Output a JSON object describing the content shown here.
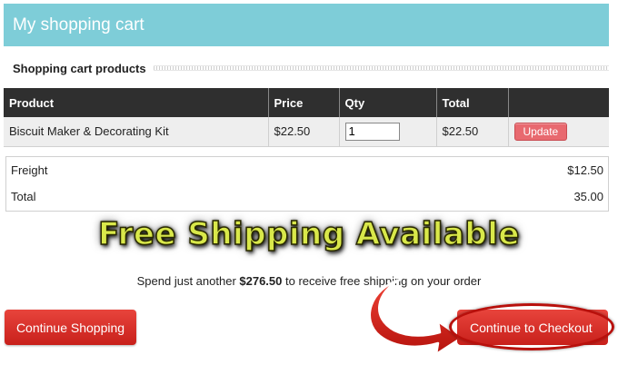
{
  "header": {
    "title": "My shopping cart"
  },
  "section": {
    "title": "Shopping cart products"
  },
  "table": {
    "columns": [
      "Product",
      "Price",
      "Qty",
      "Total",
      ""
    ],
    "rows": [
      {
        "product": "Biscuit Maker & Decorating Kit",
        "price": "$22.50",
        "qty": "1",
        "total": "$22.50",
        "action": "Update"
      }
    ]
  },
  "totals": {
    "freight_label": "Freight",
    "freight_value": "$12.50",
    "total_label": "Total",
    "total_value": "35.00"
  },
  "promo": {
    "text": "Free Shipping Available"
  },
  "notice": {
    "prefix": "Spend just another ",
    "amount": "$276.50",
    "suffix": " to receive free shipping on your order"
  },
  "buttons": {
    "continue_shopping": "Continue Shopping",
    "checkout": "Continue to Checkout"
  },
  "colors": {
    "header_bg": "#7ecdd8",
    "table_header_bg": "#2f2f2f",
    "button_red": "#d9302a",
    "update_button": "#e8696f",
    "promo_text": "#d9e84a"
  },
  "icons": {
    "arrow": "red-curved-arrow-icon"
  }
}
